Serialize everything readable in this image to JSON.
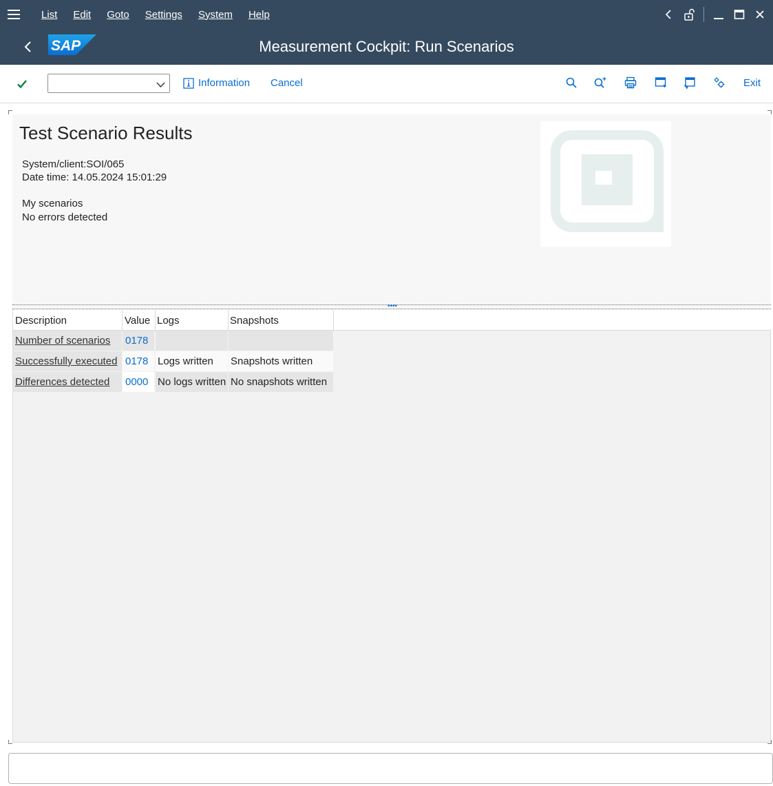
{
  "menu": {
    "items": [
      {
        "key": "list",
        "label": "List"
      },
      {
        "key": "edit",
        "label": "Edit"
      },
      {
        "key": "goto",
        "label": "Goto"
      },
      {
        "key": "settings",
        "label": "Settings"
      },
      {
        "key": "system",
        "label": "System"
      },
      {
        "key": "help",
        "label": "Help"
      }
    ]
  },
  "title": {
    "logo_text": "SAP",
    "text": "Measurement Cockpit: Run Scenarios"
  },
  "toolbar": {
    "command_field": "",
    "information_label": "Information",
    "cancel_label": "Cancel",
    "exit_label": "Exit",
    "icons": [
      "search-icon",
      "search-next-icon",
      "print-icon",
      "local-layout-icon",
      "customize-icon",
      "settings-icon"
    ]
  },
  "header": {
    "title": "Test Scenario Results",
    "system_client": "System/client:SOI/065",
    "date_time": "Date time: 14.05.2024 15:01:29",
    "scenarios_label": "My scenarios",
    "errors_text": "No errors detected"
  },
  "table": {
    "columns": [
      "Description",
      "Value",
      "Logs",
      "Snapshots"
    ],
    "rows": [
      {
        "description": "Number of scenarios",
        "value": "0178",
        "logs": "",
        "snapshots": ""
      },
      {
        "description": "Successfully executed",
        "value": "0178",
        "logs": "Logs written",
        "snapshots": "Snapshots written"
      },
      {
        "description": "Differences detected",
        "value": "0000",
        "logs": "No logs written",
        "snapshots": "No snapshots written"
      }
    ]
  },
  "colors": {
    "shell": "#354a5f",
    "link": "#0a6ed1",
    "check": "#107e3e"
  }
}
